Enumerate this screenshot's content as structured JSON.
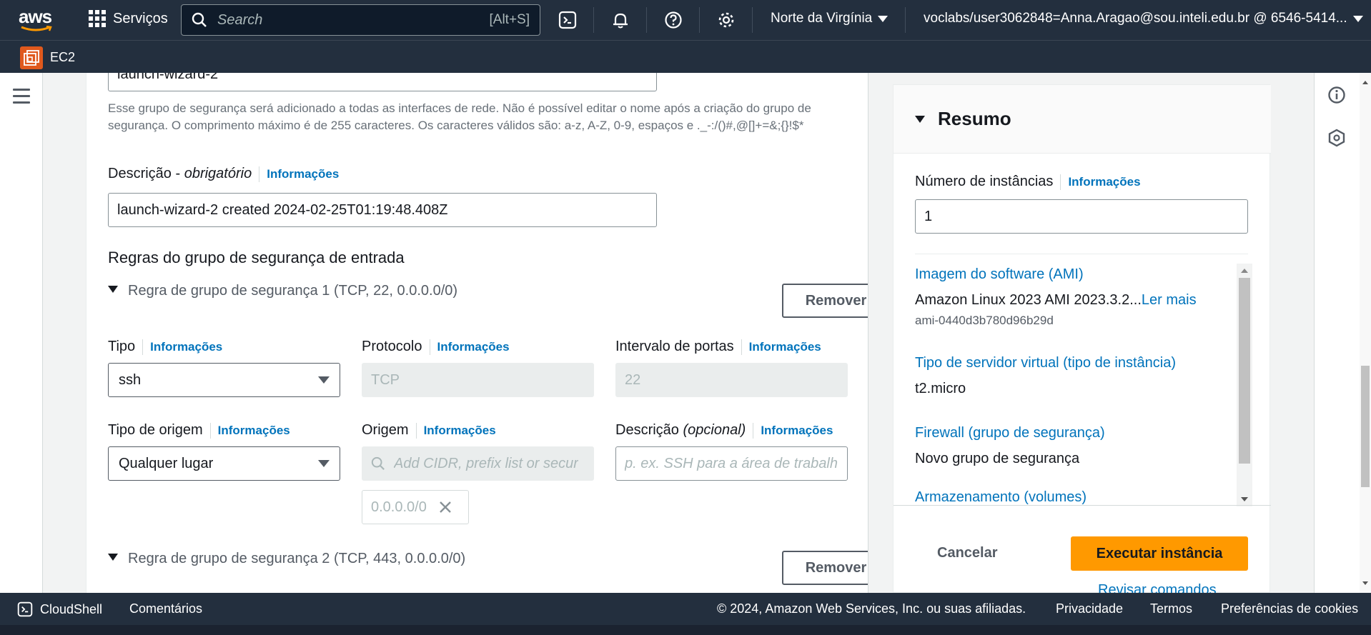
{
  "topnav": {
    "logo_text": "aws",
    "services_label": "Serviços",
    "search_placeholder": "Search",
    "search_shortcut": "[Alt+S]",
    "icons": [
      "cloudshell-icon",
      "bell-icon",
      "help-icon",
      "gear-icon"
    ],
    "region": "Norte da Virgínia",
    "account": "voclabs/user3062848=Anna.Aragao@sou.inteli.edu.br @ 6546-5414..."
  },
  "subbar": {
    "service": "EC2"
  },
  "form": {
    "sg_name_value": "launch-wizard-2",
    "sg_name_hint": "Esse grupo de segurança será adicionado a todas as interfaces de rede. Não é possível editar o nome após a criação do grupo de segurança. O comprimento máximo é de 255 caracteres. Os caracteres válidos são: a-z, A-Z, 0-9, espaços e ._-:/()#,@[]+=&;{}!$*",
    "description_label": "Descrição - ",
    "description_required": "obrigatório",
    "info": "Informações",
    "description_value": "launch-wizard-2 created 2024-02-25T01:19:48.408Z",
    "inbound_title": "Regras do grupo de segurança de entrada",
    "rule1_title": "Regra de grupo de segurança 1 (TCP, 22, 0.0.0.0/0)",
    "rule2_title": "Regra de grupo de segurança 2 (TCP, 443, 0.0.0.0/0)",
    "remove": "Remover",
    "type_label": "Tipo",
    "type_value": "ssh",
    "protocol_label": "Protocolo",
    "protocol_value": "TCP",
    "port_label": "Intervalo de portas",
    "port_value": "22",
    "source_type_label": "Tipo de origem",
    "source_type_value": "Qualquer lugar",
    "source_label": "Origem",
    "source_placeholder": "Add CIDR, prefix list or secur",
    "source_token": "0.0.0.0/0",
    "desc_opt_label": "Descrição ",
    "desc_opt_suffix": "(opcional)",
    "desc_opt_placeholder": "p. ex. SSH para a área de trabalh"
  },
  "summary": {
    "title": "Resumo",
    "instances_label": "Número de instâncias",
    "info": "Informações",
    "instances_value": "1",
    "ami_link": "Imagem do software (AMI)",
    "ami_value": "Amazon Linux 2023 AMI 2023.3.2...",
    "ami_more": "Ler mais",
    "ami_id": "ami-0440d3b780d96b29d",
    "instance_type_link": "Tipo de servidor virtual (tipo de instância)",
    "instance_type_value": "t2.micro",
    "firewall_link": "Firewall (grupo de segurança)",
    "firewall_value": "Novo grupo de segurança",
    "storage_link": "Armazenamento (volumes)",
    "cancel": "Cancelar",
    "launch": "Executar instância",
    "review": "Revisar comandos"
  },
  "footer": {
    "cloudshell": "CloudShell",
    "feedback": "Comentários",
    "copyright": "© 2024, Amazon Web Services, Inc. ou suas afiliadas.",
    "privacy": "Privacidade",
    "terms": "Termos",
    "cookies": "Preferências de cookies"
  },
  "colors": {
    "nav": "#232f3e",
    "link": "#0073bb",
    "primary": "#ff9900"
  }
}
